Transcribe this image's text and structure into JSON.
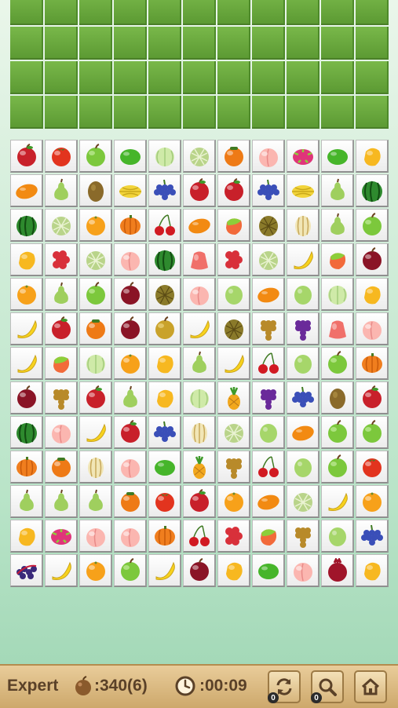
{
  "status_bar": {
    "level": "Expert",
    "score": ":340(6)",
    "timer": ":00:09",
    "score_icon": "apple-icon",
    "timer_icon": "clock-icon"
  },
  "buttons": {
    "shuffle": {
      "icon": "shuffle-icon",
      "count": "0"
    },
    "hint": {
      "icon": "magnifier-icon",
      "count": "0"
    },
    "home": {
      "icon": "home-icon"
    }
  },
  "board": {
    "columns": 11,
    "covered_rows": 4,
    "tiles": [
      [
        "apple-red",
        "tomato",
        "apple-green",
        "lime",
        "melon-green",
        "melon-net",
        "persimmon",
        "peach",
        "dragonfruit",
        "lime",
        "mango"
      ],
      [
        "mango-orange",
        "pear",
        "kiwi",
        "starfruit",
        "grapes-blue",
        "apple-red",
        "apple-red",
        "grapes-blue",
        "starfruit",
        "pear",
        "watermelon"
      ],
      [
        "watermelon",
        "melon-net",
        "orange",
        "pumpkin",
        "cherry",
        "mango-orange",
        "mango-red",
        "durian",
        "hami-melon",
        "pear",
        "apple-green"
      ],
      [
        "mango",
        "lychee",
        "melon-net",
        "peach",
        "watermelon",
        "wax-apple",
        "lychee",
        "melon-net",
        "banana",
        "mango-red",
        "plum"
      ],
      [
        "orange",
        "pear",
        "apple-green",
        "plum",
        "durian",
        "peach",
        "guava",
        "mango-orange",
        "guava",
        "melon-green",
        "mango"
      ],
      [
        "banana",
        "apple-red",
        "persimmon",
        "plum",
        "asian-pear",
        "banana",
        "durian",
        "grapes-yellow",
        "grapes-purple",
        "wax-apple",
        "peach"
      ],
      [
        "banana",
        "mango-red",
        "melon-green",
        "orange",
        "mango",
        "pear",
        "banana",
        "cherry",
        "guava",
        "apple-green",
        "pumpkin"
      ],
      [
        "plum",
        "grapes-yellow",
        "apple-red",
        "pear",
        "mango",
        "melon-green",
        "pineapple",
        "grapes-purple",
        "grapes-blue",
        "kiwi",
        "apple-red"
      ],
      [
        "watermelon",
        "peach",
        "banana",
        "apple-red",
        "grapes-blue",
        "hami-melon",
        "melon-net",
        "guava",
        "mango-orange",
        "apple-green",
        "apple-green"
      ],
      [
        "pumpkin",
        "persimmon",
        "hami-melon",
        "peach",
        "lime",
        "pineapple",
        "grapes-yellow",
        "cherry",
        "guava",
        "apple-green",
        "tomato"
      ],
      [
        "pear",
        "pear",
        "pear",
        "persimmon",
        "tomato",
        "apple-red",
        "orange",
        "mango-orange",
        "melon-net",
        "banana",
        "orange"
      ],
      [
        "mango",
        "dragonfruit",
        "peach",
        "peach",
        "pumpkin",
        "cherry",
        "lychee",
        "mango-red",
        "grapes-yellow",
        "guava",
        "grapes-blue"
      ],
      [
        "blueberry",
        "banana",
        "orange",
        "apple-green",
        "banana",
        "plum",
        "mango",
        "lime",
        "peach",
        "pomegranate",
        "mango"
      ]
    ]
  },
  "colors": {
    "cover": "#6aa83e",
    "bar": "#dcbb82",
    "text": "#5a4128"
  }
}
